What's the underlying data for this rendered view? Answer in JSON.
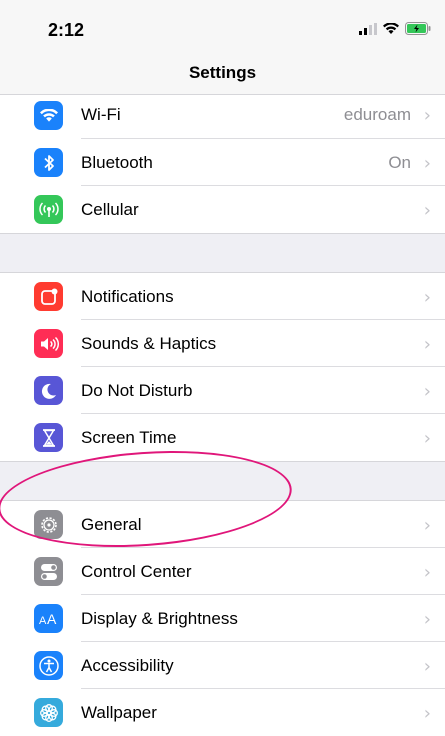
{
  "status": {
    "time": "2:12"
  },
  "nav": {
    "title": "Settings"
  },
  "group1": [
    {
      "label": "Wi-Fi",
      "value": "eduroam",
      "icon": "wifi-icon",
      "color": "#1a82fb"
    },
    {
      "label": "Bluetooth",
      "value": "On",
      "icon": "bluetooth-icon",
      "color": "#1a82fb"
    },
    {
      "label": "Cellular",
      "value": "",
      "icon": "cellular-icon",
      "color": "#34c759"
    }
  ],
  "group2": [
    {
      "label": "Notifications",
      "icon": "notifications-icon",
      "color": "#ff3b30"
    },
    {
      "label": "Sounds & Haptics",
      "icon": "speaker-icon",
      "color": "#ff2d55"
    },
    {
      "label": "Do Not Disturb",
      "icon": "moon-icon",
      "color": "#5856d6"
    },
    {
      "label": "Screen Time",
      "icon": "hourglass-icon",
      "color": "#5856d6"
    }
  ],
  "group3": [
    {
      "label": "General",
      "icon": "gear-icon",
      "color": "#8e8e93"
    },
    {
      "label": "Control Center",
      "icon": "toggles-icon",
      "color": "#8e8e93"
    },
    {
      "label": "Display & Brightness",
      "icon": "text-size-icon",
      "color": "#1a82fb"
    },
    {
      "label": "Accessibility",
      "icon": "accessibility-icon",
      "color": "#1a82fb"
    },
    {
      "label": "Wallpaper",
      "icon": "flower-icon",
      "color": "#35aadc"
    }
  ],
  "chevron": "›"
}
